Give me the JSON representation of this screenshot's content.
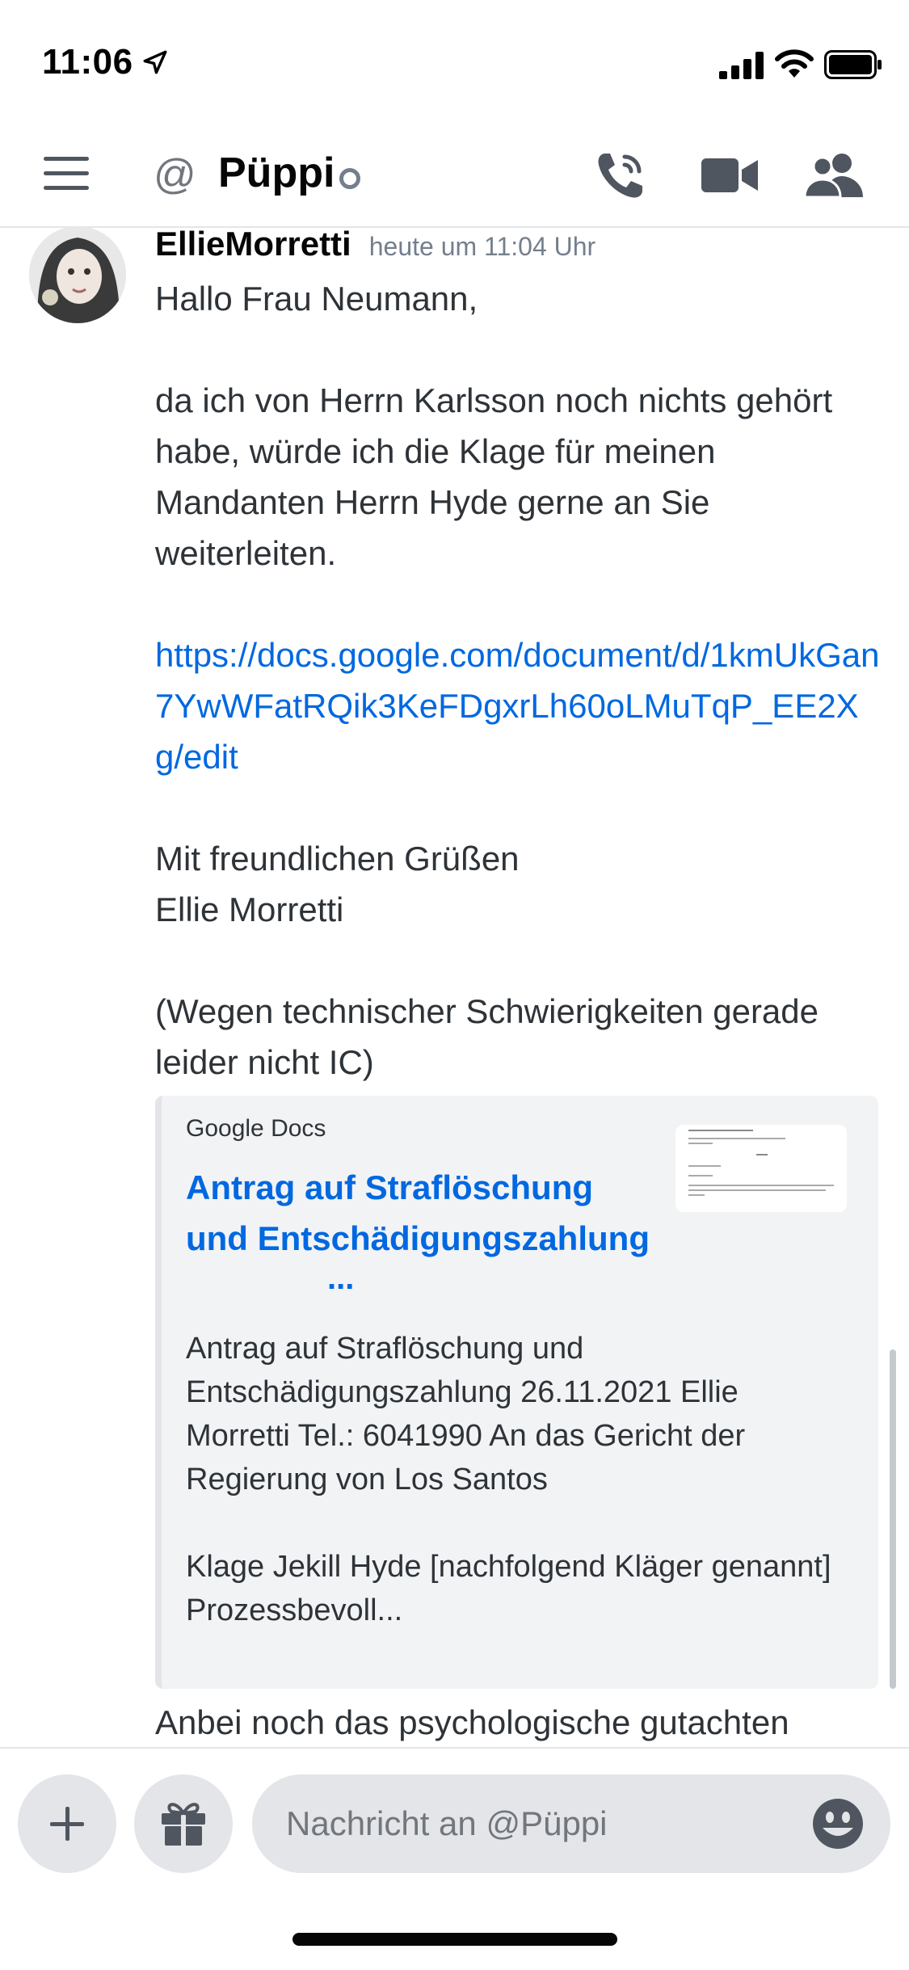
{
  "status_bar": {
    "time": "11:06"
  },
  "header": {
    "title": "Püppi"
  },
  "message": {
    "author": "EllieMorretti",
    "timestamp": "heute um 11:04 Uhr",
    "greeting": "Hallo Frau Neumann,",
    "paragraph": "da ich von Herrn Karlsson noch nichts gehört habe, würde ich die Klage für meinen Mandanten Herrn Hyde gerne an Sie weiterleiten.",
    "link": "https://docs.google.com/document/d/1kmUkGan7YwWFatRQik3KeFDgxrLh60oLMuTqP_EE2Xg/edit",
    "closing": "Mit freundlichen Grüßen",
    "signature": "Ellie Morretti",
    "note": "(Wegen technischer Schwierigkeiten gerade leider nicht IC)"
  },
  "embed": {
    "provider": "Google Docs",
    "title": "Antrag auf Straflöschung und Entschädigungszahlung",
    "title_ellipsis": "...",
    "description_line1": "Antrag auf Straflöschung und Entschädigungszahlung 26.11.2021 Ellie Morretti Tel.: 6041990   An das Gericht der Regierung von Los Santos",
    "description_line2": "Klage   Jekill Hyde [nachfolgend Kläger genannt]   Prozessbevoll..."
  },
  "next_message": {
    "text": "Anbei noch das psychologische gutachten"
  },
  "composer": {
    "placeholder": "Nachricht an @Püppi"
  },
  "icons": {
    "menu": "hamburger-menu-icon",
    "mention": "at-icon",
    "call": "phone-call-icon",
    "video": "video-camera-icon",
    "members": "members-icon",
    "add": "plus-icon",
    "gift": "gift-icon",
    "emoji": "emoji-icon"
  },
  "colors": {
    "link": "#0068e0",
    "text": "#2e3338",
    "muted": "#747f8d",
    "input_bg": "#e3e5e8",
    "embed_bg": "#f2f3f5"
  }
}
